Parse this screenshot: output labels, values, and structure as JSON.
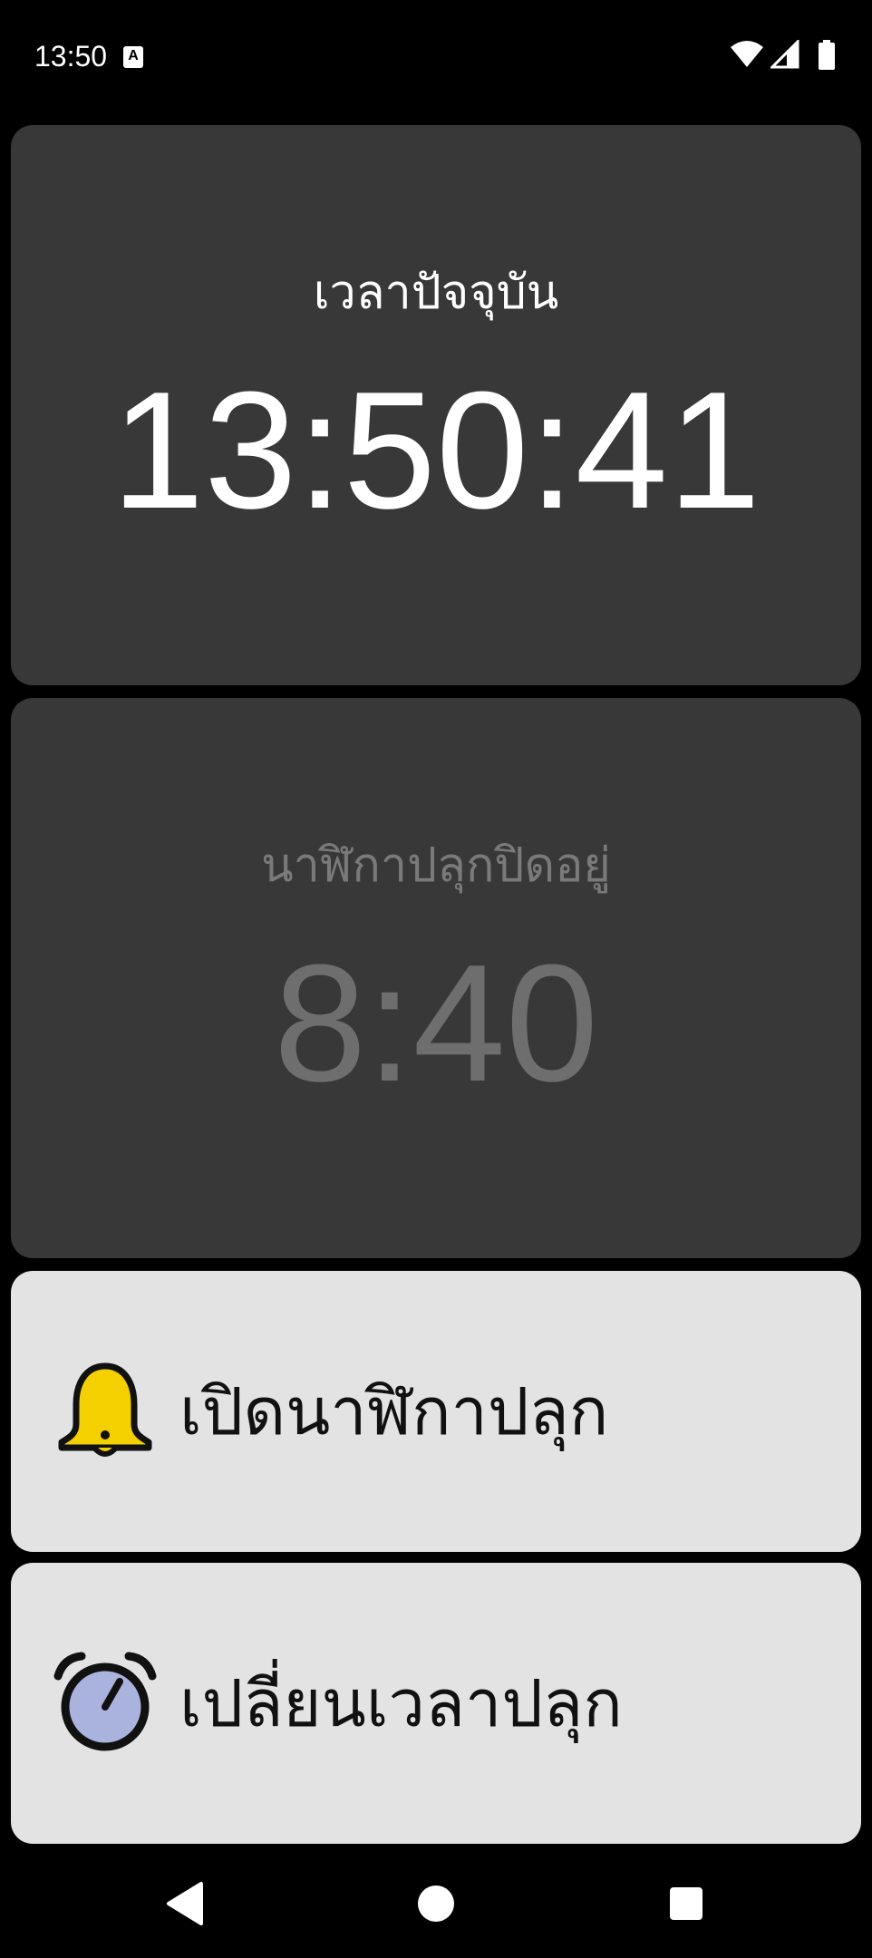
{
  "status_bar": {
    "time": "13:50",
    "notification_icon_letter": "A",
    "icons": [
      "wifi-icon",
      "signal-icon",
      "battery-icon"
    ]
  },
  "current_time_card": {
    "label": "เวลาปัจจุบัน",
    "time": "13:50:41",
    "label_color": "#ffffff",
    "time_color": "#ffffff"
  },
  "alarm_card": {
    "label": "นาฬิกาปลุกปิดอยู่",
    "time": "8:40",
    "label_color": "#7a7a7a",
    "time_color": "#6e6e6e"
  },
  "buttons": [
    {
      "label": "เปิดนาฬิกาปลุก",
      "icon": "bell-icon"
    },
    {
      "label": "เปลี่ยนเวลาปลุก",
      "icon": "alarm-clock-icon"
    }
  ],
  "nav_bar": {
    "icons": [
      "back-icon",
      "home-icon",
      "recents-icon"
    ]
  },
  "colors": {
    "card_dark": "#383838",
    "card_light": "#e3e3e3",
    "bell_yellow": "#f5d000",
    "clock_face": "#aab3dd"
  }
}
